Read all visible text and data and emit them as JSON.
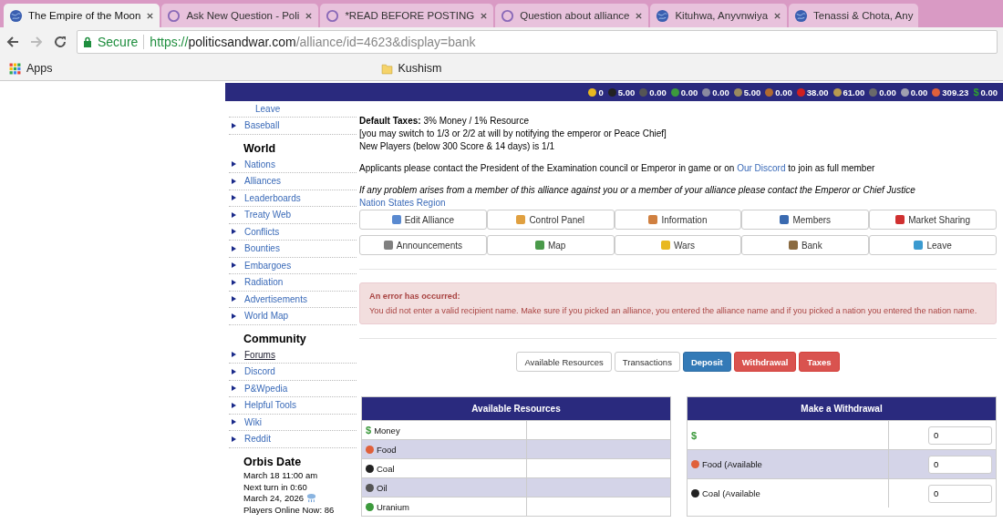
{
  "browser": {
    "tabs": [
      {
        "title": "The Empire of the Moon",
        "selected": true,
        "kind": "globe"
      },
      {
        "title": "Ask New Question - Poli",
        "selected": false,
        "kind": "ring"
      },
      {
        "title": "*READ BEFORE POSTING",
        "selected": false,
        "kind": "ring"
      },
      {
        "title": "Question about alliance",
        "selected": false,
        "kind": "ring"
      },
      {
        "title": "Kituhwa, Anyvnwiya",
        "selected": false,
        "kind": "globe"
      },
      {
        "title": "Tenassi & Chota, Any",
        "selected": false,
        "kind": "globe"
      }
    ],
    "secure_label": "Secure",
    "url": {
      "scheme": "https://",
      "host": "politicsandwar.com",
      "path": "/alliance/id=4623&display=bank"
    },
    "bookmarks": [
      {
        "label": "Apps",
        "kind": "apps"
      },
      {
        "label": "Kushism",
        "kind": "folder"
      }
    ]
  },
  "resource_bar": [
    {
      "value": "0",
      "color": "#e8b820",
      "kind": "dot"
    },
    {
      "value": "5.00",
      "color": "#222222",
      "kind": "dot"
    },
    {
      "value": "0.00",
      "color": "#555555",
      "kind": "dot"
    },
    {
      "value": "0.00",
      "color": "#3c9a3c",
      "kind": "dot"
    },
    {
      "value": "0.00",
      "color": "#8a8aa0",
      "kind": "dot"
    },
    {
      "value": "5.00",
      "color": "#9a8a60",
      "kind": "dot"
    },
    {
      "value": "0.00",
      "color": "#b06a30",
      "kind": "dot"
    },
    {
      "value": "38.00",
      "color": "#d02020",
      "kind": "dot"
    },
    {
      "value": "61.00",
      "color": "#b89a50",
      "kind": "dot"
    },
    {
      "value": "0.00",
      "color": "#6a6a6a",
      "kind": "dot"
    },
    {
      "value": "0.00",
      "color": "#a0a0b0",
      "kind": "dot"
    },
    {
      "value": "309.23",
      "color": "#e0603a",
      "kind": "dot"
    },
    {
      "value": "0.00",
      "symbol": "$",
      "color": "#2ea02e",
      "kind": "symbol"
    }
  ],
  "sidebar": {
    "sub_items": [
      "Leave"
    ],
    "top_items": [
      "Baseball"
    ],
    "sections": [
      {
        "heading": "World",
        "items": [
          {
            "label": "Nations",
            "hovered": false
          },
          {
            "label": "Alliances",
            "hovered": false
          },
          {
            "label": "Leaderboards",
            "hovered": false
          },
          {
            "label": "Treaty Web",
            "hovered": false
          },
          {
            "label": "Conflicts",
            "hovered": false
          },
          {
            "label": "Bounties",
            "hovered": false
          },
          {
            "label": "Embargoes",
            "hovered": false
          },
          {
            "label": "Radiation",
            "hovered": false
          },
          {
            "label": "Advertisements",
            "hovered": false
          },
          {
            "label": "World Map",
            "hovered": false
          }
        ]
      },
      {
        "heading": "Community",
        "items": [
          {
            "label": "Forums",
            "hovered": true
          },
          {
            "label": "Discord",
            "hovered": false
          },
          {
            "label": "P&Wpedia",
            "hovered": false
          },
          {
            "label": "Helpful Tools",
            "hovered": false
          },
          {
            "label": "Wiki",
            "hovered": false
          },
          {
            "label": "Reddit",
            "hovered": false
          }
        ]
      }
    ],
    "orbis": {
      "heading": "Orbis Date",
      "lines": [
        "March 18 11:00 am",
        "Next turn in 0:60",
        "March 24, 2026",
        "Players Online Now: 86"
      ]
    }
  },
  "description": {
    "tax_lines": [
      "**Default Taxes:** 3% Money / 1% Resource",
      "[you may switch to 1/3 or 2/2 at will by notifying the emperor or Peace Chief]",
      "New Players (below 300 Score & 14 days) is 1/1"
    ],
    "applicants": {
      "before": "Applicants please contact the President of the Examination council or Emperor in game or on",
      "link": "Our Discord",
      "after": "to join as full member"
    },
    "notice": "If any problem arises from a member of this alliance against you or a member of your alliance please contact the Emperor or Chief Justice",
    "region_link": "Nation States Region"
  },
  "alliance_buttons": [
    {
      "label": "Edit Alliance",
      "color": "#5a8ad0"
    },
    {
      "label": "Control Panel",
      "color": "#e0a040"
    },
    {
      "label": "Information",
      "color": "#d08040"
    },
    {
      "label": "Members",
      "color": "#3a6ab0"
    },
    {
      "label": "Market Sharing",
      "color": "#d03030"
    },
    {
      "label": "Announcements",
      "color": "#808080"
    },
    {
      "label": "Map",
      "color": "#4a9a4a"
    },
    {
      "label": "Wars",
      "color": "#e8b820"
    },
    {
      "label": "Bank",
      "color": "#8a6a40"
    },
    {
      "label": "Leave",
      "color": "#3a9ad0"
    }
  ],
  "error": {
    "title": "An error has occurred:",
    "message": "You did not enter a valid recipient name. Make sure if you picked an alliance, you entered the alliance name and if you picked a nation you entered the nation name."
  },
  "bank_tabs": [
    {
      "label": "Available Resources",
      "kind": "default"
    },
    {
      "label": "Transactions",
      "kind": "default"
    },
    {
      "label": "Deposit",
      "kind": "primary"
    },
    {
      "label": "Withdrawal",
      "kind": "danger"
    },
    {
      "label": "Taxes",
      "kind": "danger"
    }
  ],
  "available_resources": {
    "title": "Available Resources",
    "rows": [
      {
        "label": "Money",
        "icon": "$",
        "color": "#3c9a3c"
      },
      {
        "label": "Food",
        "color": "#e0603a"
      },
      {
        "label": "Coal",
        "color": "#222222"
      },
      {
        "label": "Oil",
        "color": "#555555"
      },
      {
        "label": "Uranium",
        "color": "#3c9a3c"
      }
    ]
  },
  "withdrawal": {
    "title": "Make a Withdrawal",
    "rows": [
      {
        "icon": "$",
        "color": "#3c9a3c",
        "value": "0"
      },
      {
        "label": "Food (Available",
        "color": "#e0603a",
        "value": "0"
      },
      {
        "label": "Coal (Available",
        "color": "#222222",
        "value": "0"
      }
    ]
  }
}
